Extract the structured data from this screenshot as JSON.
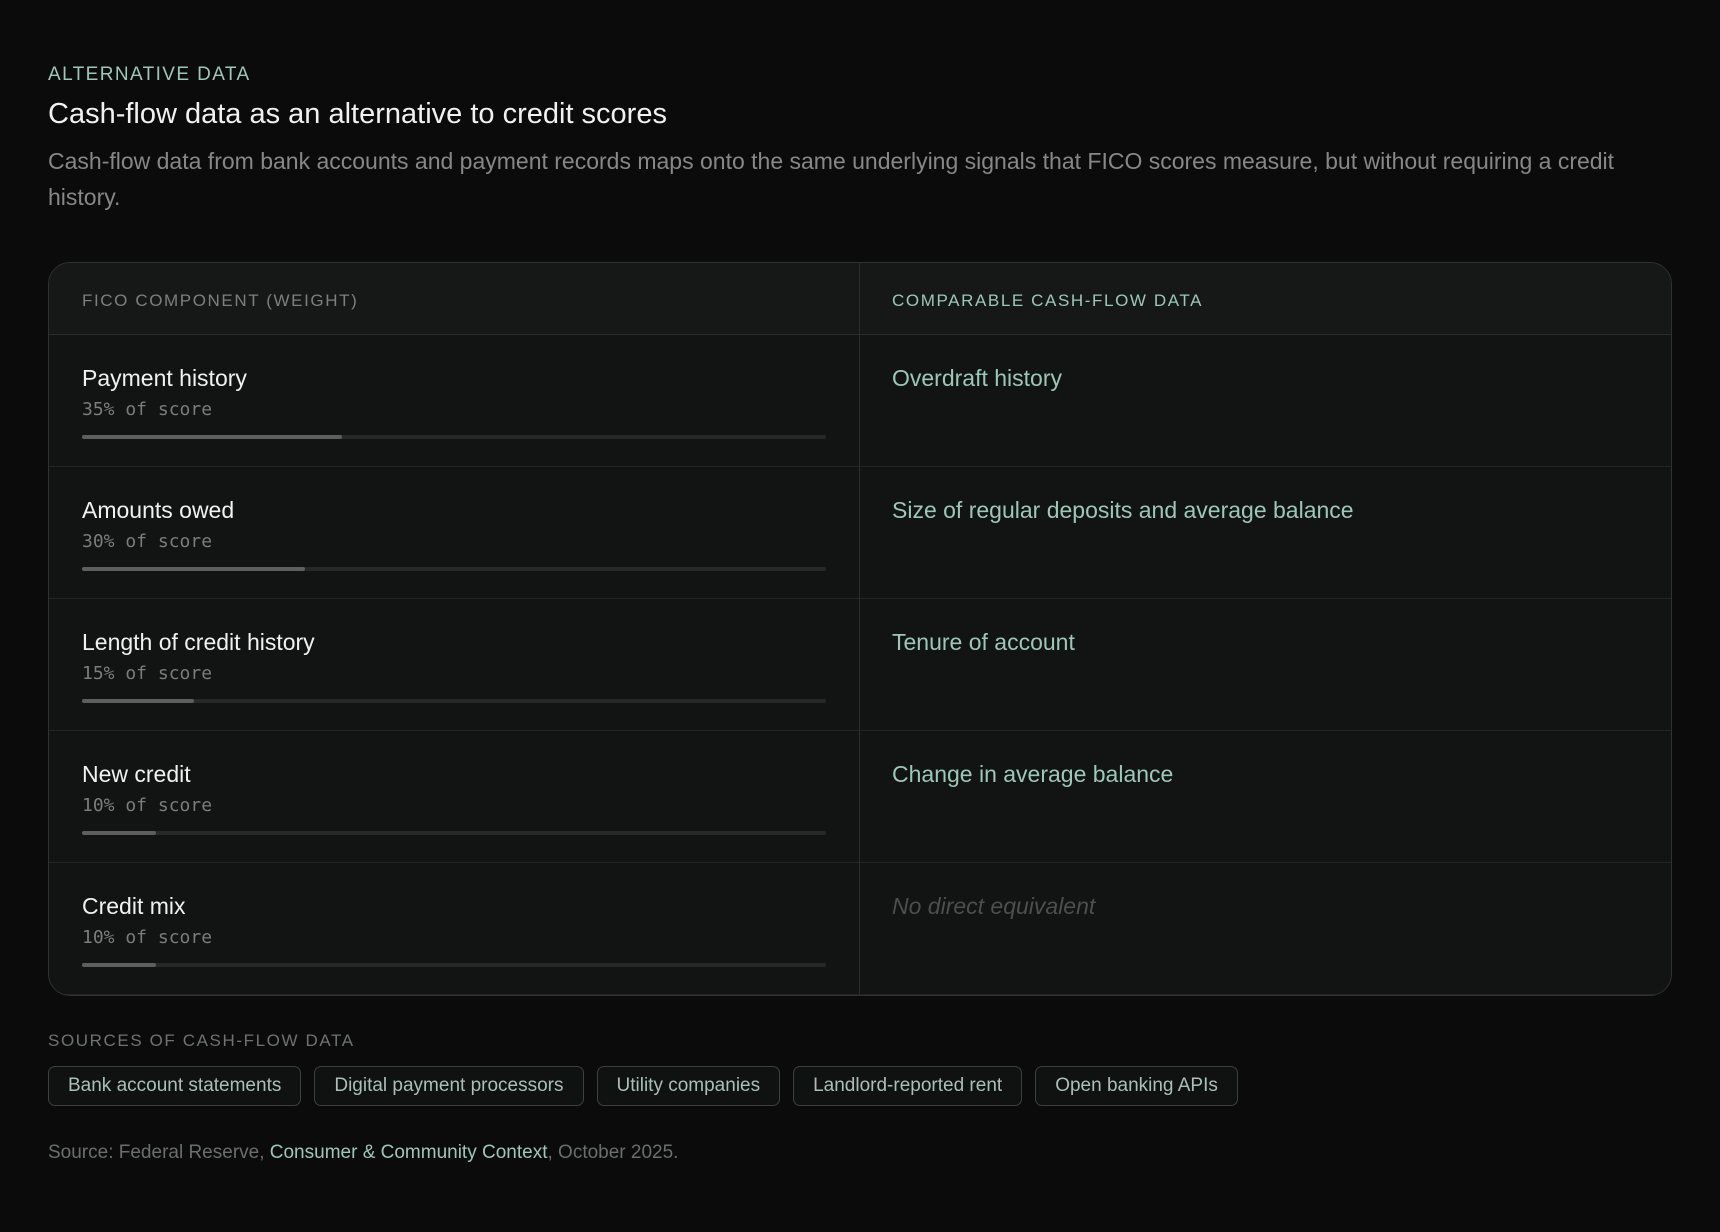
{
  "header": {
    "eyebrow": "ALTERNATIVE DATA",
    "title": "Cash-flow data as an alternative to credit scores",
    "subtitle": "Cash-flow data from bank accounts and payment records maps onto the same underlying signals that FICO scores measure, but without requiring a credit history."
  },
  "table": {
    "header_left": "FICO COMPONENT (WEIGHT)",
    "header_right": "COMPARABLE CASH-FLOW DATA",
    "rows": [
      {
        "name": "Payment history",
        "weight_label": "35% of score",
        "weight_pct": 35,
        "equivalent": "Overdraft history",
        "has_equivalent": true
      },
      {
        "name": "Amounts owed",
        "weight_label": "30% of score",
        "weight_pct": 30,
        "equivalent": "Size of regular deposits and average balance",
        "has_equivalent": true
      },
      {
        "name": "Length of credit history",
        "weight_label": "15% of score",
        "weight_pct": 15,
        "equivalent": "Tenure of account",
        "has_equivalent": true
      },
      {
        "name": "New credit",
        "weight_label": "10% of score",
        "weight_pct": 10,
        "equivalent": "Change in average balance",
        "has_equivalent": true
      },
      {
        "name": "Credit mix",
        "weight_label": "10% of score",
        "weight_pct": 10,
        "equivalent": "No direct equivalent",
        "has_equivalent": false
      }
    ]
  },
  "sources": {
    "label": "SOURCES OF CASH-FLOW DATA",
    "chips": [
      "Bank account statements",
      "Digital payment processors",
      "Utility companies",
      "Landlord-reported rent",
      "Open banking APIs"
    ]
  },
  "footer": {
    "prefix": "Source: Federal Reserve, ",
    "link": "Consumer & Community Context",
    "suffix": ", October 2025."
  },
  "colors": {
    "accent": "#9cc8b8",
    "background": "#0b0b0b",
    "card": "#121313",
    "bar_fill": "#5b605e"
  }
}
